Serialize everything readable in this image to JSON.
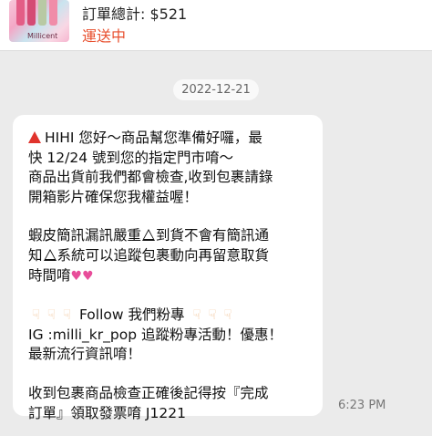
{
  "order": {
    "total_label": "訂單總計:",
    "total_value": "$521",
    "status": "運送中",
    "thumbnail_brand": "Millicent"
  },
  "chat": {
    "date_separator": "2022-12-21",
    "message": {
      "p1": [
        "HIHI 您好～商品幫您準備好囉，最",
        "快 12/24 號到您的指定門市唷～",
        "商品出貨前我們都會檢查,收到包裹請錄",
        "開箱影片確保您我權益喔！"
      ],
      "p2_line1_a": "蝦皮簡訊漏訊嚴重",
      "p2_line1_b": "到貨不會有簡訊通",
      "p2_line2_a": "知",
      "p2_line2_b": "系統可以追蹤包裹動向再留意取貨",
      "p2_line3": "時間唷",
      "p3_line1": "Follow 我們粉專",
      "p3_line2": "IG :milli_kr_pop 追蹤粉專活動！優惠！",
      "p3_line3": "最新流行資訊唷！",
      "p4": [
        "收到包裹商品檢查正確後記得按『完成",
        "訂單』領取發票唷 J1221"
      ]
    },
    "timestamp": "6:23 PM"
  },
  "icons": {
    "alert": "red-triangle-icon",
    "warning": "warning-sign-icon",
    "hand": "backhand-index-pointing-down-icon",
    "hearts": "two-hearts-icon"
  },
  "colors": {
    "background": "#ebebeb",
    "bubble": "#ffffff",
    "status": "#e8502f",
    "alert": "#e0332c"
  }
}
